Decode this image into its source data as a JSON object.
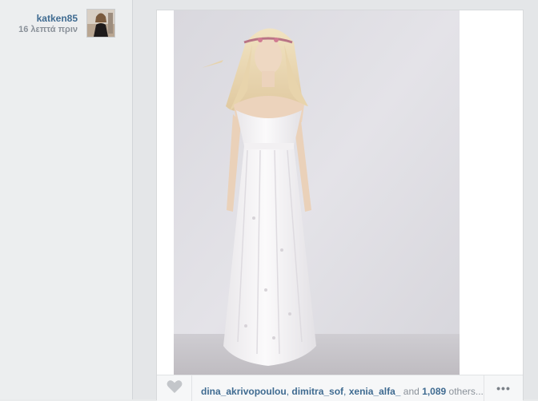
{
  "post": {
    "username": "katken85",
    "timestamp": "16 λεπτά πριν",
    "avatar_icon": "user-avatar-photo",
    "photo_description_icon": "post-photo"
  },
  "likes": {
    "users": [
      "dina_akrivopoulou",
      "dimitra_sof",
      "xenia_alfa_"
    ],
    "and_label": "and",
    "count": "1,089",
    "others_label": "others..."
  },
  "actions": {
    "like_icon": "heart-icon",
    "more_label": "•••"
  },
  "colors": {
    "link": "#3f6b91",
    "muted": "#8a9199",
    "background": "#e9ebec"
  }
}
